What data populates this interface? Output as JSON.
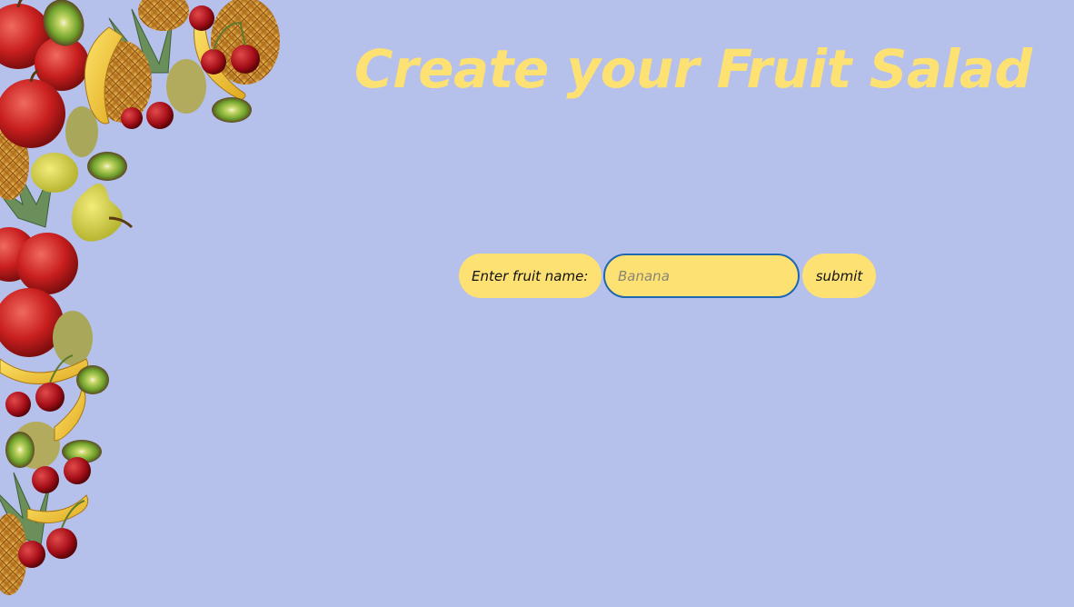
{
  "page": {
    "title": "Create your Fruit Salad"
  },
  "form": {
    "label": "Enter fruit name:",
    "input_value": "",
    "input_placeholder": "Banana",
    "submit_label": "submit"
  },
  "colors": {
    "background": "#b5c0eb",
    "accent_yellow": "#fee173",
    "input_focus_border": "#1f67b0"
  },
  "decoration": {
    "fruit_border_items": [
      "apple-icon",
      "kiwi-icon",
      "banana-icon",
      "pineapple-icon",
      "cherry-icon",
      "pear-icon"
    ]
  }
}
